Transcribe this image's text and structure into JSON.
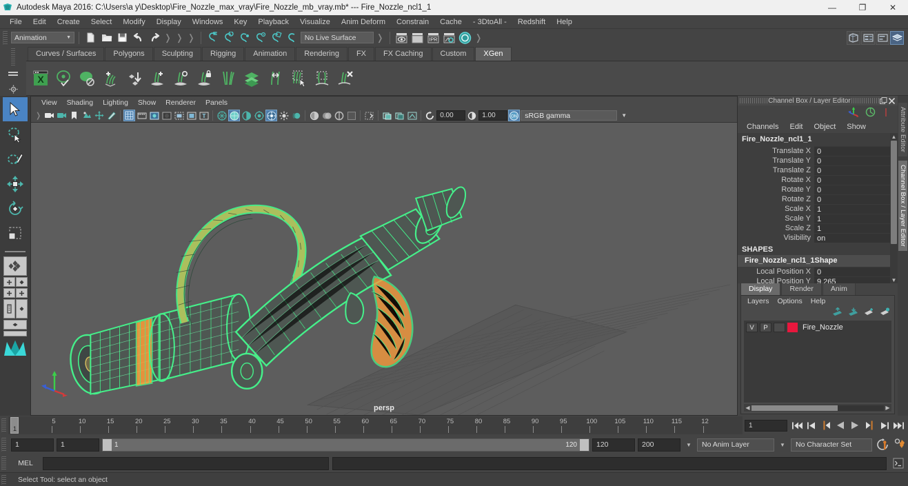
{
  "window": {
    "title": "Autodesk Maya 2016: C:\\Users\\a y\\Desktop\\Fire_Nozzle_max_vray\\Fire_Nozzle_mb_vray.mb*  ---  Fire_Nozzle_ncl1_1",
    "minimize": "—",
    "restore": "❐",
    "close": "✕"
  },
  "menubar": {
    "items": [
      "File",
      "Edit",
      "Create",
      "Select",
      "Modify",
      "Display",
      "Windows",
      "Key",
      "Playback",
      "Visualize",
      "Anim Deform",
      "Constrain",
      "Cache",
      "- 3DtoAll -",
      "Redshift",
      "Help"
    ]
  },
  "statusline": {
    "mode": "Animation",
    "live_surface": "No Live Surface"
  },
  "shelf": {
    "tabs": [
      "Curves / Surfaces",
      "Polygons",
      "Sculpting",
      "Rigging",
      "Animation",
      "Rendering",
      "FX",
      "FX Caching",
      "Custom",
      "XGen"
    ],
    "active_tab": "XGen",
    "icons": [
      "xgen-editor-icon",
      "xgen-preview-icon",
      "xgen-disable-preview-icon",
      "xgen-add-guides-icon",
      "xgen-place-guide-icon",
      "xgen-grow-add-icon",
      "xgen-grow-eye-icon",
      "xgen-grow-lock-icon",
      "xgen-part-icon",
      "xgen-layers-icon",
      "xgen-length-icon",
      "xgen-select-guides-icon",
      "xgen-region-icon",
      "xgen-delete-guides-icon"
    ]
  },
  "toolbox": {
    "tools": [
      "select-tool",
      "lasso-select-tool",
      "paint-select-tool",
      "move-tool",
      "rotate-tool",
      "scale-tool"
    ],
    "selected": "select-tool",
    "layouts": [
      "single-view-layout",
      "four-view-layout",
      "two-pane-layout",
      "persp-outliner-layout",
      "maya-logo"
    ]
  },
  "viewport": {
    "menus": [
      "View",
      "Shading",
      "Lighting",
      "Show",
      "Renderer",
      "Panels"
    ],
    "exposure": "0.00",
    "gamma": "1.00",
    "color_profile": "sRGB gamma",
    "camera_label": "persp",
    "axis": {
      "x": "X",
      "y": "Y",
      "z": "Z"
    },
    "model_name": "Fire_Nozzle_ncl1_1",
    "wire_color": "#45f08a",
    "wire_accent": "#ff9d3a",
    "bg_color": "#5d5d5d"
  },
  "channel_box": {
    "panel_title": "Channel Box / Layer Editor",
    "menus": [
      "Channels",
      "Edit",
      "Object",
      "Show"
    ],
    "object_name": "Fire_Nozzle_ncl1_1",
    "attributes": [
      {
        "label": "Translate X",
        "value": "0"
      },
      {
        "label": "Translate Y",
        "value": "0"
      },
      {
        "label": "Translate Z",
        "value": "0"
      },
      {
        "label": "Rotate X",
        "value": "0"
      },
      {
        "label": "Rotate Y",
        "value": "0"
      },
      {
        "label": "Rotate Z",
        "value": "0"
      },
      {
        "label": "Scale X",
        "value": "1"
      },
      {
        "label": "Scale Y",
        "value": "1"
      },
      {
        "label": "Scale Z",
        "value": "1"
      },
      {
        "label": "Visibility",
        "value": "on"
      }
    ],
    "shapes_header": "SHAPES",
    "shape_name": "Fire_Nozzle_ncl1_1Shape",
    "shape_attributes": [
      {
        "label": "Local Position X",
        "value": "0"
      },
      {
        "label": "Local Position Y",
        "value": "9.265"
      }
    ]
  },
  "side_tabs": {
    "attribute_editor": "Attribute Editor",
    "channel_box": "Channel Box / Layer Editor"
  },
  "layer_editor": {
    "tabs": [
      "Display",
      "Render",
      "Anim"
    ],
    "active_tab": "Display",
    "menus": [
      "Layers",
      "Options",
      "Help"
    ],
    "layers": [
      {
        "v": "V",
        "p": "P",
        "third": "",
        "color": "#e8173d",
        "name": "Fire_Nozzle"
      }
    ]
  },
  "timeslider": {
    "labels": [
      "5",
      "10",
      "15",
      "20",
      "25",
      "30",
      "35",
      "40",
      "45",
      "50",
      "55",
      "60",
      "65",
      "70",
      "75",
      "80",
      "85",
      "90",
      "95",
      "100",
      "105",
      "110",
      "115",
      "12"
    ],
    "current_frame": "1",
    "frame_field": "1",
    "playback_buttons": [
      "go-to-start-icon",
      "step-back-keyframe-icon",
      "step-back-frame-icon",
      "play-backwards-icon",
      "play-forwards-icon",
      "step-forward-frame-icon",
      "step-forward-keyframe-icon",
      "go-to-end-icon"
    ]
  },
  "rangeslider": {
    "start_field": "1",
    "range_start_field": "1",
    "range_bar_start": "1",
    "range_bar_end": "120",
    "range_end_field": "120",
    "end_field": "200",
    "anim_layer": "No Anim Layer",
    "character_set": "No Character Set"
  },
  "command_line": {
    "label": "MEL",
    "input_value": "",
    "output_value": ""
  },
  "help_line": {
    "text": "Select Tool: select an object"
  }
}
